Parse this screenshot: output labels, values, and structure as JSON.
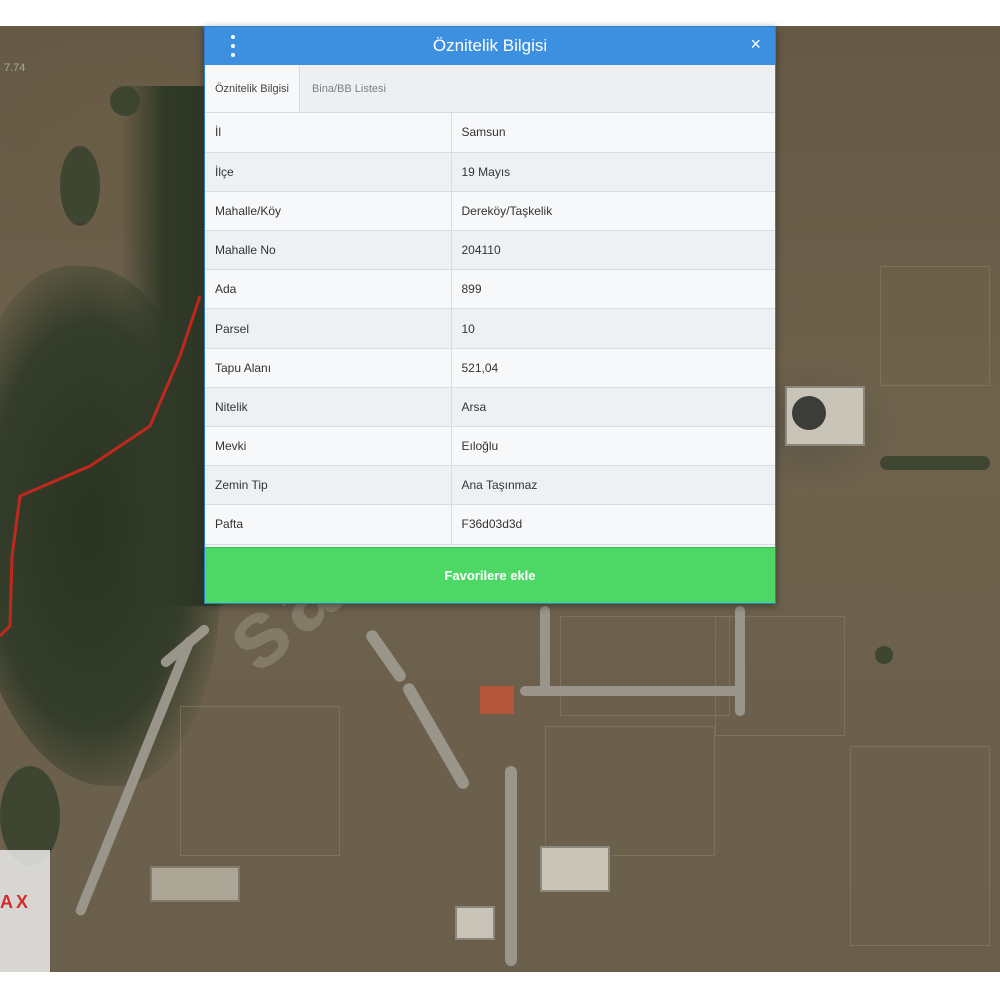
{
  "map": {
    "corner_text": "7.74",
    "watermark": "sahibi",
    "logo_text": "AX",
    "colors": {
      "boundary": "#c0281e",
      "terrain": "#6a5f4b"
    }
  },
  "panel": {
    "title": "Öznitelik Bilgisi",
    "close_label": "×",
    "tabs": [
      {
        "label": "Öznitelik Bilgisi",
        "active": true
      },
      {
        "label": "Bina/BB Listesi",
        "active": false
      }
    ],
    "rows": [
      {
        "key": "İl",
        "value": "Samsun"
      },
      {
        "key": "İlçe",
        "value": "19 Mayıs"
      },
      {
        "key": "Mahalle/Köy",
        "value": "Dereköy/Taşkelik"
      },
      {
        "key": "Mahalle No",
        "value": "204110"
      },
      {
        "key": "Ada",
        "value": "899"
      },
      {
        "key": "Parsel",
        "value": "10"
      },
      {
        "key": "Tapu Alanı",
        "value": "521,04"
      },
      {
        "key": "Nitelik",
        "value": "Arsa"
      },
      {
        "key": "Mevki",
        "value": "Eıloğlu"
      },
      {
        "key": "Zemin Tip",
        "value": "Ana Taşınmaz"
      },
      {
        "key": "Pafta",
        "value": "F36d03d3d"
      }
    ],
    "favorite_button": "Favorilere ekle",
    "colors": {
      "header": "#3d8fe0",
      "button": "#4dd866"
    }
  }
}
